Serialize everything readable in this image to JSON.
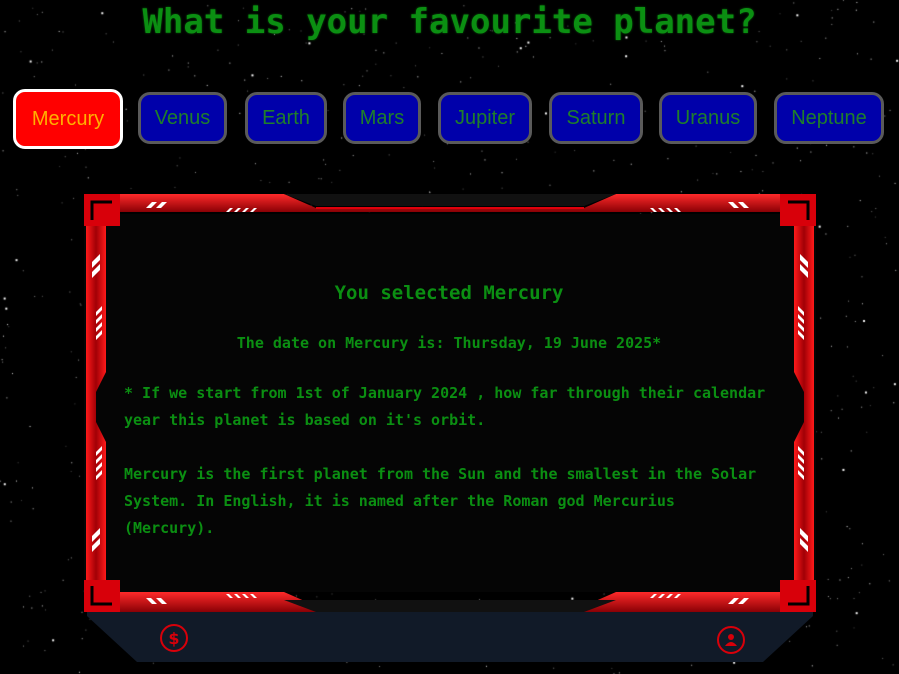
{
  "title": "What is your favourite planet?",
  "planets": [
    {
      "label": "Mercury",
      "selected": true
    },
    {
      "label": "Venus",
      "selected": false
    },
    {
      "label": "Earth",
      "selected": false
    },
    {
      "label": "Mars",
      "selected": false
    },
    {
      "label": "Jupiter",
      "selected": false
    },
    {
      "label": "Saturn",
      "selected": false
    },
    {
      "label": "Uranus",
      "selected": false
    },
    {
      "label": "Neptune",
      "selected": false
    }
  ],
  "panel": {
    "selected_text": "You selected Mercury",
    "date_text": "The date on Mercury is: Thursday, 19 June 2025*",
    "footnote": "* If we start from 1st of January 2024 , how far through their calendar year this planet is based on it's orbit.",
    "description": "Mercury is the first planet from the Sun and the smallest in the Solar System. In English, it is named after the Roman god Mercurius (Mercury)."
  },
  "footer_icons": {
    "left": "$",
    "left_icon": "dollar-icon",
    "right_icon": "user-icon"
  },
  "colors": {
    "background": "#000000",
    "text_green": "#0b8f12",
    "button_blue": "#0000aa",
    "selected_red": "#ff0000",
    "selected_text": "#ffb000",
    "frame_red": "#e0000b"
  }
}
